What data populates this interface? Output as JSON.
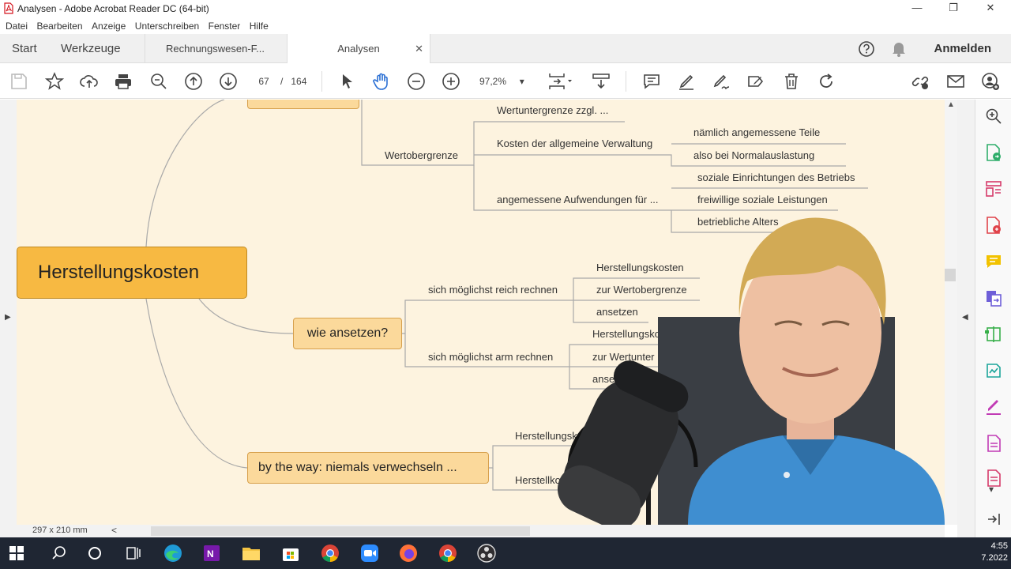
{
  "window": {
    "title": "Analysen - Adobe Acrobat Reader DC (64-bit)",
    "controls": {
      "minimize": "—",
      "maximize": "❐",
      "close": "✕"
    }
  },
  "menu": [
    "Datei",
    "Bearbeiten",
    "Anzeige",
    "Unterschreiben",
    "Fenster",
    "Hilfe"
  ],
  "tabs": {
    "home": "Start",
    "tools": "Werkzeuge",
    "doc1": "Rechnungswesen-F...",
    "doc2": "Analysen",
    "close": "✕"
  },
  "header_right": {
    "signin": "Anmelden"
  },
  "toolbar": {
    "page_current": "67",
    "page_separator": "/",
    "page_total": "164",
    "zoom": "97,2%"
  },
  "status": {
    "page_size": "297 x 210 mm",
    "scroll_left": "<"
  },
  "mindmap": {
    "central": "Herstellungskosten",
    "topics": {
      "how": "wie ansetzen?",
      "btw": "by the way: niemals verwechseln ..."
    },
    "wertobergrenze": "Wertobergrenze",
    "wertuntergrenze": "Wertuntergrenze zzgl. ...",
    "kosten_verwaltung": "Kosten der allgemeine Verwaltung",
    "naemlich": "nämlich angemessene Teile",
    "normalauslastung": "also bei Normalauslastung",
    "aufwendungen": "angemessene Aufwendungen für ...",
    "soziale_einrichtungen": "soziale Einrichtungen des Betriebs",
    "freiwillige": "freiwillige soziale Leistungen",
    "betriebliche": "betriebliche Alters",
    "reich": "sich möglichst reich rechnen",
    "reich_children": [
      "Herstellungskosten",
      "zur Wertobergrenze",
      "ansetzen"
    ],
    "arm": "sich möglichst arm rechnen",
    "arm_children": [
      "Herstellungsko",
      "zur Wertunter",
      "ansetzen"
    ],
    "btw_children": [
      "Herstellungskosten",
      "Herstellko"
    ]
  },
  "taskbar": {
    "time": "4:55",
    "date": "7.2022"
  },
  "colors": {
    "central": "#f7b942",
    "topic": "#fbd99b",
    "canvas": "#fdf3df",
    "taskbar": "#1f2633",
    "accent": "#2a6fd4"
  }
}
